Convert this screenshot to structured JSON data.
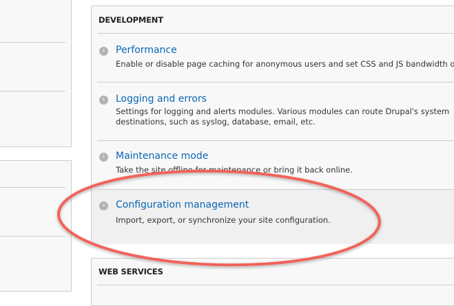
{
  "development": {
    "heading": "DEVELOPMENT",
    "items": [
      {
        "title": "Performance",
        "desc": [
          "Enable or disable page caching for anonymous users and set CSS and JS bandwidth o"
        ]
      },
      {
        "title": "Logging and errors",
        "desc": [
          "Settings for logging and alerts modules. Various modules can route Drupal's system",
          "destinations, such as syslog, database, email, etc."
        ]
      },
      {
        "title": "Maintenance mode",
        "desc": [
          "Take the site offline for maintenance or bring it back online."
        ]
      },
      {
        "title": "Configuration management",
        "desc": [
          "Import, export, or synchronize your site configuration."
        ]
      }
    ]
  },
  "web_services": {
    "heading": "WEB SERVICES"
  },
  "annotation": {
    "color": "#f0625a",
    "highlighted_item": "Configuration management"
  },
  "icons": {
    "item_icon": "chevron-circle-right-icon"
  }
}
